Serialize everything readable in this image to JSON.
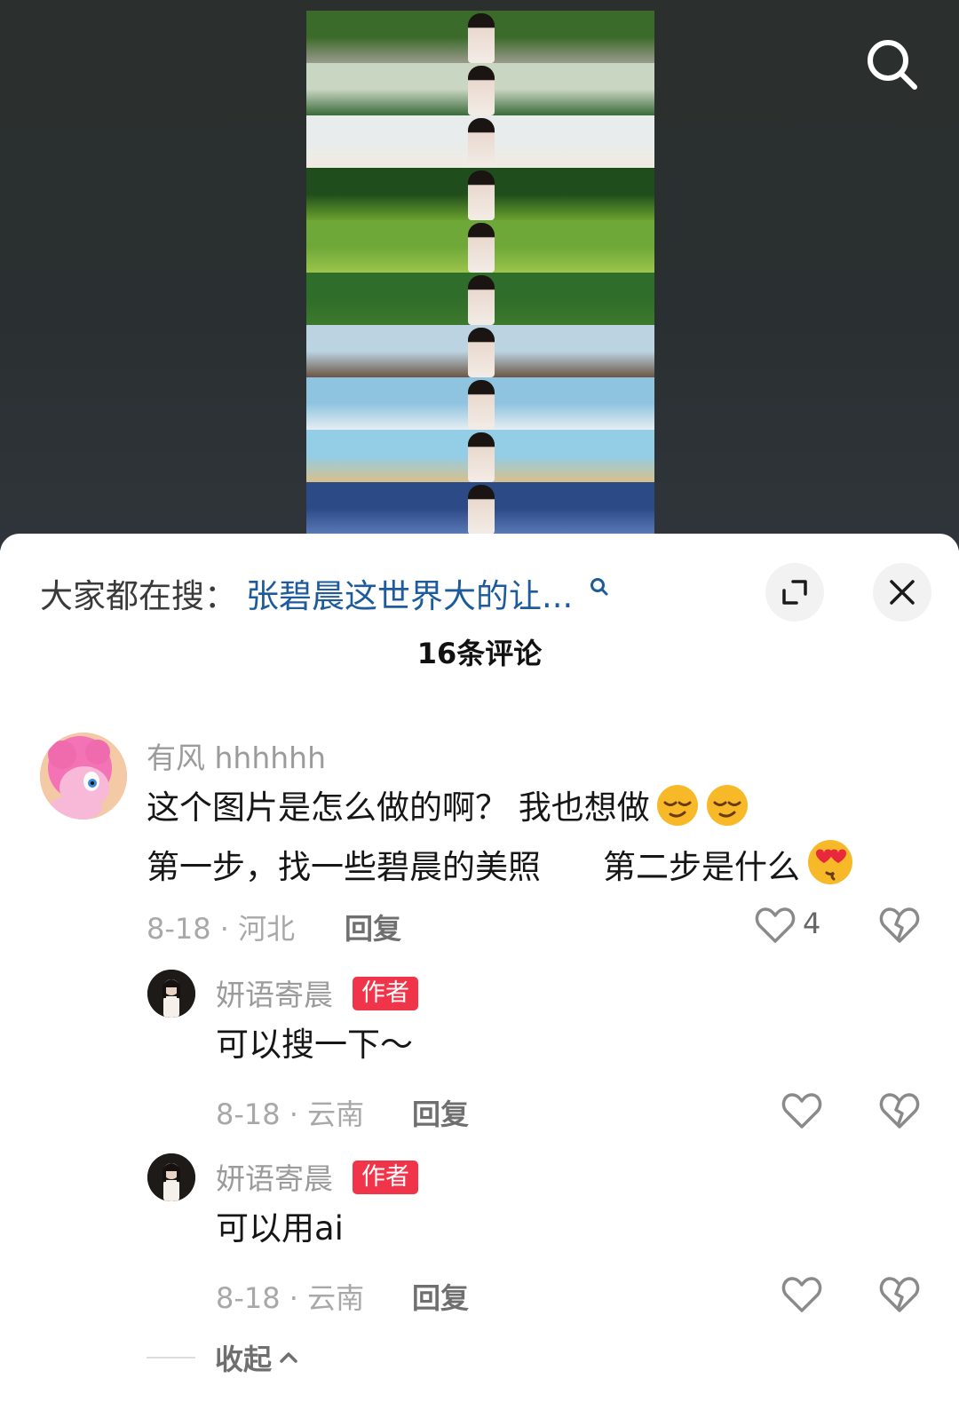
{
  "header": {
    "search_icon": "search-icon"
  },
  "collage": {
    "strips": [
      {
        "sky": "#3a6b2a",
        "ground": "#9a9a8c"
      },
      {
        "sky": "#c9d6c2",
        "ground": "#3a6a3a"
      },
      {
        "sky": "#e8ecec",
        "ground": "#f1ebe1"
      },
      {
        "sky": "#1f4d1c",
        "ground": "#6aa12c"
      },
      {
        "sky": "#6ea838",
        "ground": "#9bc44a"
      },
      {
        "sky": "#2f6d2a",
        "ground": "#3b7a2c"
      },
      {
        "sky": "#bcd4e2",
        "ground": "#6a5644"
      },
      {
        "sky": "#8fc4e0",
        "ground": "#e6eef2"
      },
      {
        "sky": "#93cde6",
        "ground": "#d8c08a"
      },
      {
        "sky": "#2c4a86",
        "ground": "#5a7ab8"
      }
    ]
  },
  "sheet": {
    "search_prefix": "大家都在搜：",
    "search_topic": "张碧晨这世界大的让...",
    "expand_icon": "expand-icon",
    "close_icon": "close-icon",
    "comment_count": "16条评论"
  },
  "comments": [
    {
      "user": "有风 hhhhhh",
      "line1": "这个图片是怎么做的啊？ 我也想做",
      "line2": "第一步，找一些碧晨的美照",
      "line2b": "第二步是什么",
      "date_location": "8-18 · 河北",
      "reply": "回复",
      "likes": "4"
    },
    {
      "user": "妍语寄晨",
      "badge": "作者",
      "text": "可以搜一下～",
      "date_location": "8-18 · 云南",
      "reply": "回复"
    },
    {
      "user": "妍语寄晨",
      "badge": "作者",
      "text": "可以用ai",
      "date_location": "8-18 · 云南",
      "reply": "回复"
    }
  ],
  "collapse": {
    "label": "收起"
  }
}
